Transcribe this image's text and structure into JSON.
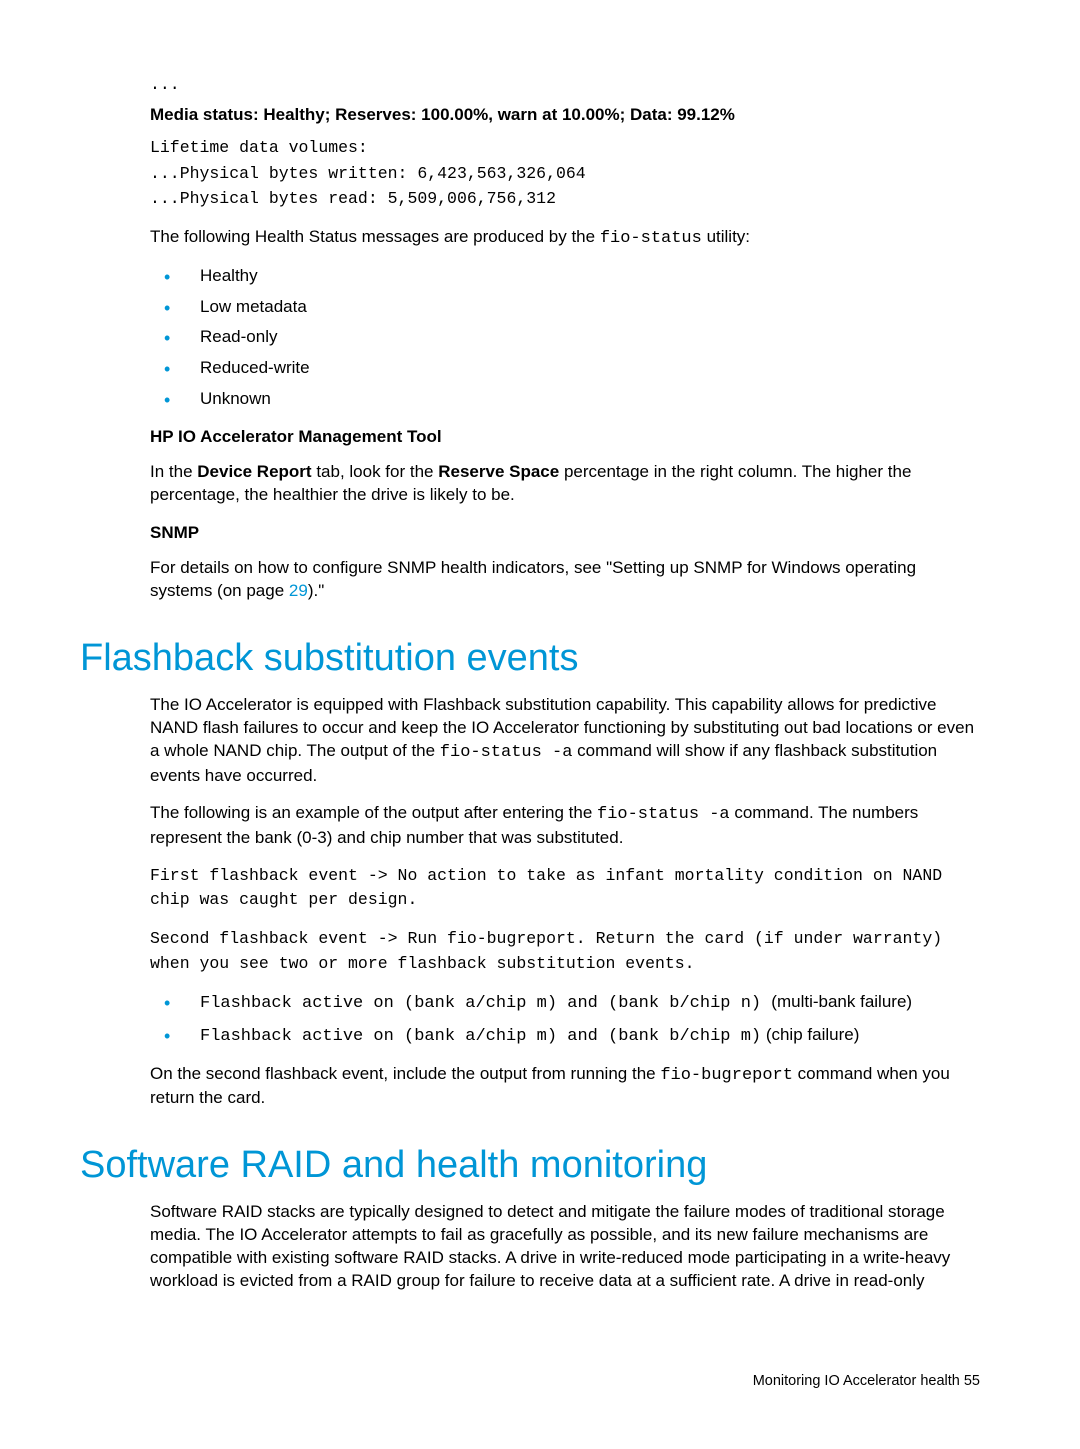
{
  "top": {
    "ellipsis": "...",
    "media_status_bold": "Media status: Healthy; Reserves: 100.00%, warn at 10.00%; Data: 99.12%",
    "lifetime_line": "Lifetime data volumes:",
    "written_line": "...Physical bytes written: 6,423,563,326,064",
    "read_line": "...Physical bytes read: 5,509,006,756,312"
  },
  "status_intro": {
    "pre": "The following Health Status messages are produced by the ",
    "code": "fio-status",
    "post": " utility:"
  },
  "status_list": [
    "Healthy",
    "Low metadata",
    "Read-only",
    "Reduced-write",
    "Unknown"
  ],
  "mgmt_tool": {
    "heading": "HP IO Accelerator Management Tool",
    "p1_a": "In the ",
    "p1_b_bold": "Device Report",
    "p1_c": " tab, look for the ",
    "p1_d_bold": "Reserve Space",
    "p1_e": " percentage in the right column. The higher the percentage, the healthier the drive is likely to be."
  },
  "snmp": {
    "heading": "SNMP",
    "p_a": "For details on how to configure SNMP health indicators, see \"Setting up SNMP for Windows operating systems (on page ",
    "p_link": "29",
    "p_b": ").\""
  },
  "flashback": {
    "title": "Flashback substitution events",
    "p1_a": "The IO Accelerator is equipped with Flashback substitution capability. This capability allows for predictive NAND flash failures to occur and keep the IO Accelerator functioning   by substituting out bad locations or even a whole NAND chip. The output of the ",
    "p1_code": "fio-status -a",
    "p1_b": " command will show if any flashback substitution events have occurred.",
    "p2_a": "The following is an example of the output after entering the ",
    "p2_code": "fio-status -a",
    "p2_b": " command. The numbers represent the bank (0-3) and chip number that was substituted.",
    "code1": "First flashback event -> No action to take as infant mortality condition on NAND chip was caught per design.",
    "code2": "Second flashback event -> Run fio-bugreport. Return the card (if under warranty) when you see two or more flashback substitution events.",
    "li1_code": "Flashback active on (bank a/chip m) and (bank b/chip n) ",
    "li1_text": " (multi-bank failure)",
    "li2_code": "Flashback active on (bank a/chip m) and (bank b/chip m)",
    "li2_text": " (chip failure)",
    "p3_a": "On the second flashback event, include the output from running the ",
    "p3_code": "fio-bugreport",
    "p3_b": " command when you return the card."
  },
  "raid": {
    "title": "Software RAID and health monitoring",
    "p1": "Software RAID stacks are typically designed to detect and mitigate the failure modes of traditional storage media. The IO Accelerator attempts to fail as gracefully as possible, and its new failure mechanisms are compatible with existing software RAID stacks. A drive in write-reduced mode participating in a write-heavy workload is evicted from a RAID group for failure to receive data at a sufficient rate. A drive in read-only"
  },
  "footer": {
    "text": "Monitoring IO Accelerator health   55"
  }
}
